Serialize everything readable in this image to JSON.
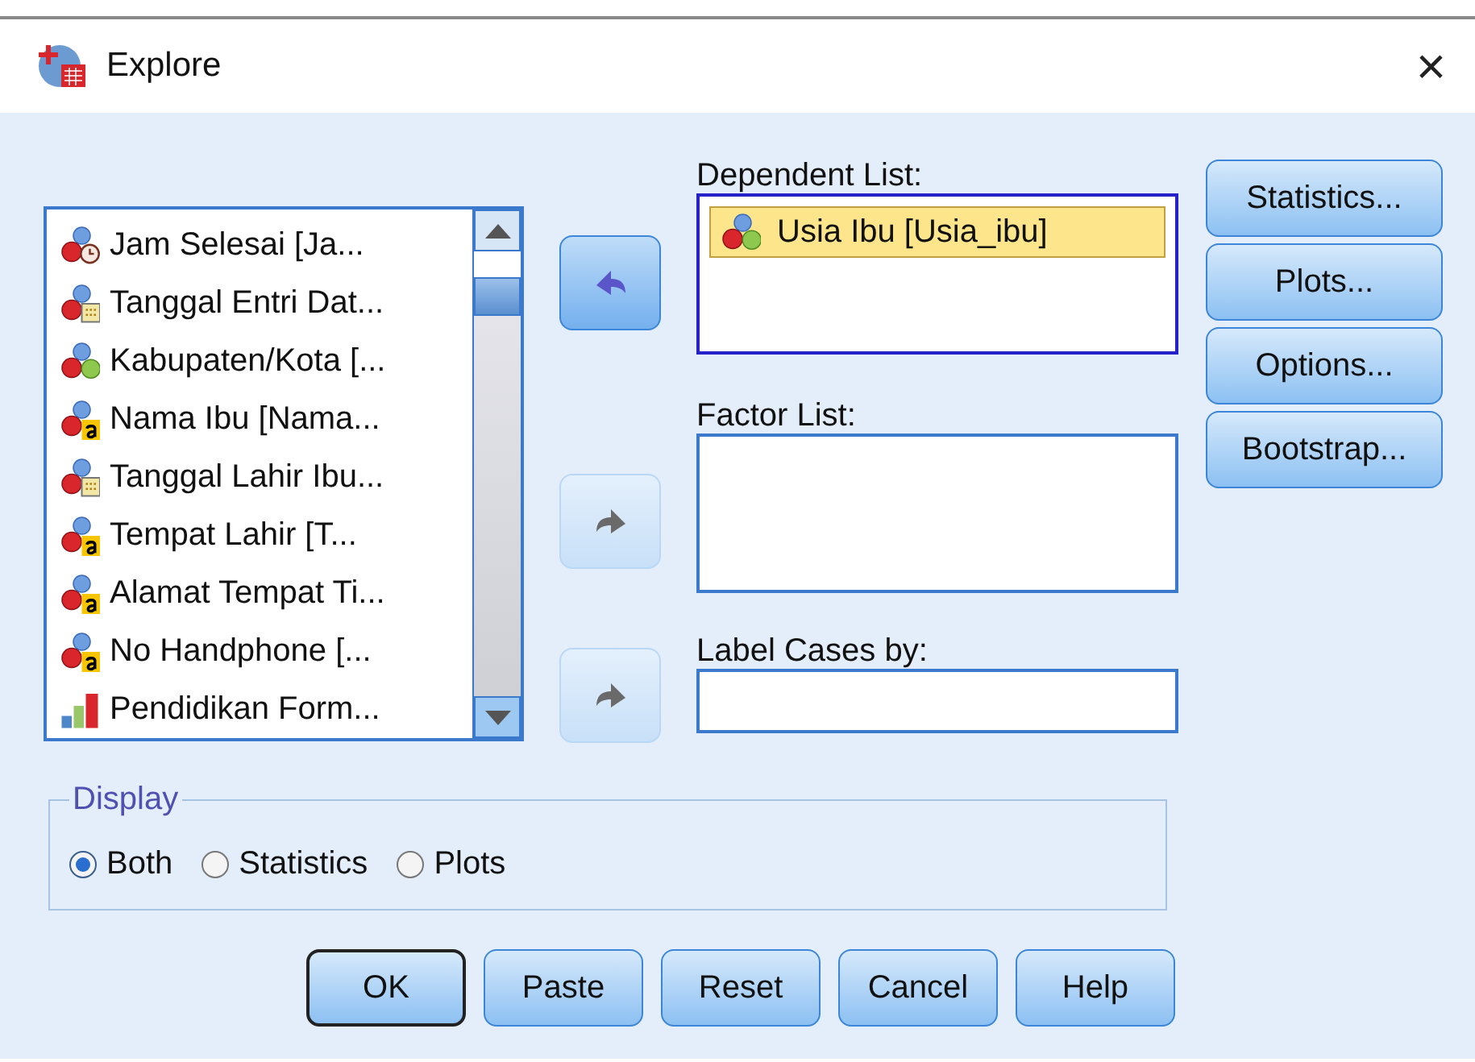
{
  "window": {
    "title": "Explore",
    "close": "×"
  },
  "source_list": {
    "items": [
      {
        "label": "Jam Selesai [Ja...",
        "kind": "time"
      },
      {
        "label": "Tanggal Entri Dat...",
        "kind": "date"
      },
      {
        "label": "Kabupaten/Kota [...",
        "kind": "nominal"
      },
      {
        "label": "Nama Ibu [Nama...",
        "kind": "string"
      },
      {
        "label": "Tanggal Lahir Ibu...",
        "kind": "date"
      },
      {
        "label": "Tempat Lahir [T...",
        "kind": "string"
      },
      {
        "label": "Alamat Tempat Ti...",
        "kind": "string"
      },
      {
        "label": "No Handphone  [...",
        "kind": "string"
      },
      {
        "label": "Pendidikan Form...",
        "kind": "ordinal"
      }
    ]
  },
  "transfer_buttons": [
    {
      "kind": "left",
      "disabled": false
    },
    {
      "kind": "right",
      "disabled": true
    },
    {
      "kind": "right",
      "disabled": true
    }
  ],
  "dependent_list": {
    "label": "Dependent List:",
    "items": [
      {
        "label": "Usia Ibu [Usia_ibu]",
        "kind": "nominal",
        "selected": true
      }
    ]
  },
  "factor_list": {
    "label": "Factor List:"
  },
  "label_cases": {
    "label": "Label Cases by:"
  },
  "side_buttons": [
    "Statistics...",
    "Plots...",
    "Options...",
    "Bootstrap..."
  ],
  "display": {
    "title": "Display",
    "options": [
      {
        "label": "Both",
        "selected": true
      },
      {
        "label": "Statistics",
        "selected": false
      },
      {
        "label": "Plots",
        "selected": false
      }
    ]
  },
  "buttons": [
    {
      "label": "OK",
      "default": true
    },
    {
      "label": "Paste",
      "default": false
    },
    {
      "label": "Reset",
      "default": false
    },
    {
      "label": "Cancel",
      "default": false
    },
    {
      "label": "Help",
      "default": false
    }
  ]
}
